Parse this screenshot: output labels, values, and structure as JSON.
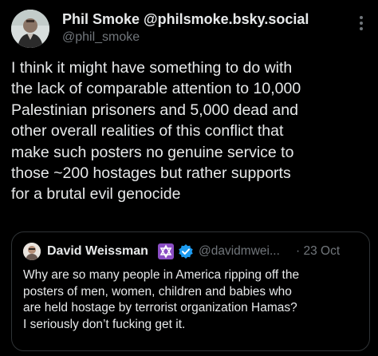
{
  "post": {
    "author": {
      "display_name": "Phil Smoke",
      "handle_display": "@philsmoke.bsky.social",
      "username": "@phil_smoke"
    },
    "more_icon": "ellipsis-vertical-icon",
    "text_lines": [
      "I think it might have something to do with",
      "the lack of comparable attention to 10,000",
      "Palestinian prisoners and 5,000 dead and",
      "other overall realities of this conflict that",
      "make such posters no genuine service to",
      "those ~200 hostages but rather supports",
      "for a brutal evil genocide"
    ]
  },
  "quote": {
    "author": {
      "display_name": "David Weissman",
      "emoji_icon": "star-of-david-icon",
      "verified_icon": "verified-badge-icon",
      "handle": "@davidmwei...",
      "separator": "·",
      "timestamp": "23 Oct"
    },
    "text_lines": [
      "Why are so many people in America ripping off the",
      "posters of  men, women, children and babies who",
      "are held hostage by terrorist organization Hamas?",
      "I seriously don’t fucking get it."
    ]
  },
  "colors": {
    "background": "#000000",
    "primary_text": "#e7e9ea",
    "secondary_text": "#71767b",
    "border": "#2f3336",
    "verified_blue": "#1d9bf0",
    "emoji_purple": "#8b4ec4"
  }
}
